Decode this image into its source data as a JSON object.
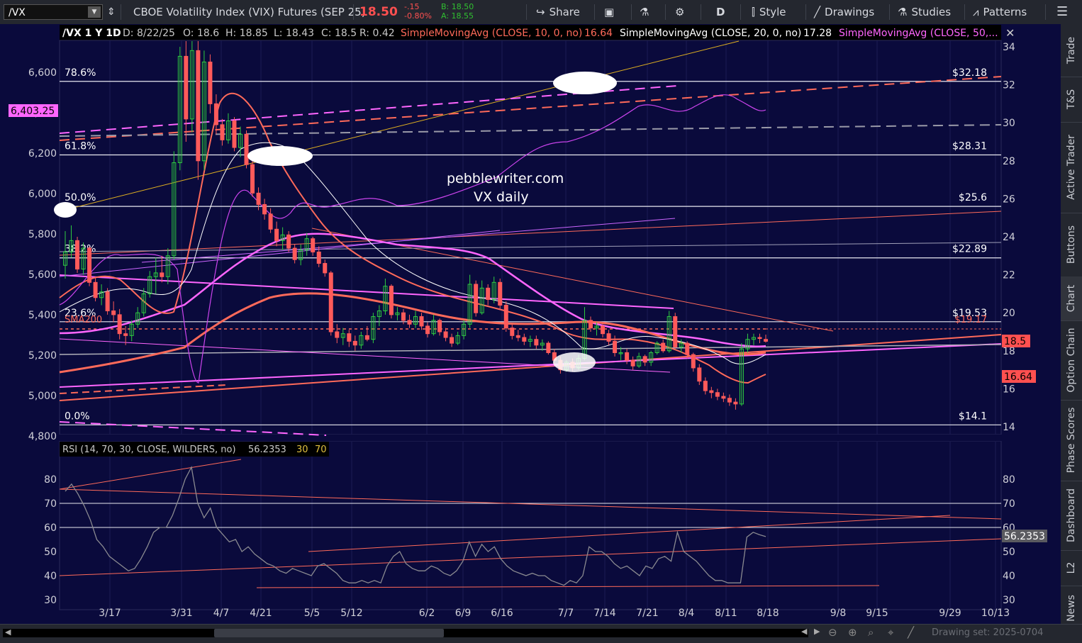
{
  "toolbar": {
    "symbol": "/VX",
    "description": "CBOE Volatility Index (VIX) Futures (SEP 25)",
    "last": "18.50",
    "change": "-.15",
    "change_pct": "-0.80%",
    "bid": "B: 18.50",
    "ask": "A: 18.55",
    "share": "Share",
    "aggregation": "D",
    "style": "Style",
    "drawings": "Drawings",
    "studies": "Studies",
    "patterns": "Patterns"
  },
  "header": {
    "symbol_period": "/VX 1 Y 1D",
    "date": "D: 8/22/25",
    "open": "O: 18.6",
    "high": "H: 18.85",
    "low": "L: 18.43",
    "close": "C: 18.5",
    "range": "R: 0.42",
    "sma10_label": "SimpleMovingAvg (CLOSE, 10, 0, no)",
    "sma10_value": "16.64",
    "sma20_label": "SimpleMovingAvg (CLOSE, 20, 0, no)",
    "sma20_value": "17.28",
    "sma50_label": "SimpleMovingAvg (CLOSE, 50,..."
  },
  "sidebar": {
    "tabs": [
      "Trade",
      "T&S",
      "Active Trader",
      "Buttons",
      "Chart",
      "Option Chain",
      "Phase Scores",
      "Dashboard",
      "L2",
      "News"
    ]
  },
  "watermark": {
    "line1": "pebblewriter.com",
    "line2": "VX daily"
  },
  "rsi_header": {
    "label": "RSI (14, 70, 30, CLOSE, WILDERS, no)",
    "value": "56.2353",
    "os": "30",
    "ob": "70"
  },
  "bottom": {
    "drawing_set": "Drawing set: 2025-0704"
  },
  "chart_data": [
    {
      "type": "candlestick",
      "title": "/VX 1 Y 1D",
      "right_axis": {
        "range": [
          14,
          34
        ],
        "ticks": [
          14,
          16,
          18,
          20,
          22,
          24,
          26,
          28,
          30,
          32,
          34
        ]
      },
      "left_axis": {
        "range": [
          4800,
          6600
        ],
        "ticks": [
          "4,800",
          "5,000",
          "5,200",
          "5,400",
          "5,600",
          "5,800",
          "6,000",
          "6,200",
          "6,400",
          "6,600"
        ],
        "marker": "6,403.25"
      },
      "x_ticks": [
        "3/17",
        "3/31",
        "4/7",
        "4/21",
        "5/5",
        "5/12",
        "6/2",
        "6/9",
        "6/16",
        "7/7",
        "7/14",
        "7/21",
        "8/4",
        "8/11",
        "8/18",
        "9/8",
        "9/15",
        "9/29",
        "10/13"
      ],
      "fib_levels": [
        {
          "pct": "78.6%",
          "price": "$32.18",
          "value": 32.18
        },
        {
          "pct": "61.8%",
          "price": "$28.31",
          "value": 28.31
        },
        {
          "pct": "50.0%",
          "price": "$25.6",
          "value": 25.6
        },
        {
          "pct": "38.2%",
          "price": "$22.89",
          "value": 22.89
        },
        {
          "pct": "23.6%",
          "price": "$19.53",
          "value": 19.53
        },
        {
          "pct": "0.0%",
          "price": "$14.1",
          "value": 14.1
        }
      ],
      "annotations": {
        "sma200_label": "SMA200",
        "sma200_price": "$19.17",
        "last_price": "18.5",
        "sma10_price": "16.64"
      },
      "candles": [
        {
          "d": "3/10",
          "o": 22.5,
          "h": 24.3,
          "l": 21.8,
          "c": 23.2
        },
        {
          "d": "3/11",
          "o": 23.2,
          "h": 24.6,
          "l": 22.9,
          "c": 23.8
        },
        {
          "d": "3/12",
          "o": 23.8,
          "h": 24.0,
          "l": 22.1,
          "c": 22.3
        },
        {
          "d": "3/13",
          "o": 22.3,
          "h": 23.7,
          "l": 22.0,
          "c": 23.4
        },
        {
          "d": "3/14",
          "o": 23.4,
          "h": 23.5,
          "l": 21.4,
          "c": 21.6
        },
        {
          "d": "3/17",
          "o": 21.6,
          "h": 21.9,
          "l": 20.6,
          "c": 20.8
        },
        {
          "d": "3/18",
          "o": 20.8,
          "h": 21.5,
          "l": 20.4,
          "c": 21.1
        },
        {
          "d": "3/19",
          "o": 21.1,
          "h": 21.3,
          "l": 19.9,
          "c": 20.1
        },
        {
          "d": "3/20",
          "o": 20.1,
          "h": 20.6,
          "l": 19.5,
          "c": 19.9
        },
        {
          "d": "3/21",
          "o": 19.9,
          "h": 20.2,
          "l": 18.6,
          "c": 18.9
        },
        {
          "d": "3/24",
          "o": 18.9,
          "h": 19.3,
          "l": 18.3,
          "c": 18.8
        },
        {
          "d": "3/25",
          "o": 18.8,
          "h": 19.6,
          "l": 18.5,
          "c": 19.4
        },
        {
          "d": "3/26",
          "o": 19.4,
          "h": 20.3,
          "l": 19.2,
          "c": 20.0
        },
        {
          "d": "3/27",
          "o": 20.0,
          "h": 21.3,
          "l": 19.8,
          "c": 21.0
        },
        {
          "d": "3/28",
          "o": 21.0,
          "h": 22.2,
          "l": 20.8,
          "c": 21.9
        },
        {
          "d": "3/31",
          "o": 21.9,
          "h": 22.9,
          "l": 21.0,
          "c": 22.1
        },
        {
          "d": "4/1",
          "o": 22.1,
          "h": 23.0,
          "l": 21.6,
          "c": 21.9
        },
        {
          "d": "4/2",
          "o": 21.9,
          "h": 23.4,
          "l": 21.5,
          "c": 23.0
        },
        {
          "d": "4/3",
          "o": 23.0,
          "h": 28.5,
          "l": 22.8,
          "c": 27.9
        },
        {
          "d": "4/4",
          "o": 27.9,
          "h": 34.0,
          "l": 27.5,
          "c": 33.5
        },
        {
          "d": "4/7",
          "o": 33.5,
          "h": 36.5,
          "l": 29.0,
          "c": 30.2
        },
        {
          "d": "4/8",
          "o": 30.2,
          "h": 34.8,
          "l": 29.5,
          "c": 33.8
        },
        {
          "d": "4/9",
          "o": 33.8,
          "h": 34.5,
          "l": 27.0,
          "c": 28.0
        },
        {
          "d": "4/10",
          "o": 28.0,
          "h": 33.8,
          "l": 27.5,
          "c": 33.2
        },
        {
          "d": "4/11",
          "o": 33.2,
          "h": 33.6,
          "l": 30.5,
          "c": 31.0
        },
        {
          "d": "4/14",
          "o": 31.0,
          "h": 31.5,
          "l": 29.4,
          "c": 29.9
        },
        {
          "d": "4/15",
          "o": 29.9,
          "h": 30.2,
          "l": 28.8,
          "c": 29.1
        },
        {
          "d": "4/16",
          "o": 29.1,
          "h": 30.5,
          "l": 28.9,
          "c": 30.1
        },
        {
          "d": "4/17",
          "o": 30.1,
          "h": 30.3,
          "l": 28.5,
          "c": 28.7
        },
        {
          "d": "4/21",
          "o": 28.7,
          "h": 29.8,
          "l": 28.2,
          "c": 29.4
        },
        {
          "d": "4/22",
          "o": 29.4,
          "h": 29.6,
          "l": 27.6,
          "c": 27.8
        },
        {
          "d": "4/23",
          "o": 27.8,
          "h": 28.0,
          "l": 26.1,
          "c": 26.3
        },
        {
          "d": "4/24",
          "o": 26.3,
          "h": 26.6,
          "l": 25.4,
          "c": 25.7
        },
        {
          "d": "4/25",
          "o": 25.7,
          "h": 26.0,
          "l": 24.9,
          "c": 25.2
        },
        {
          "d": "4/28",
          "o": 25.2,
          "h": 25.5,
          "l": 24.2,
          "c": 24.4
        },
        {
          "d": "4/29",
          "o": 24.4,
          "h": 24.8,
          "l": 23.5,
          "c": 23.8
        },
        {
          "d": "4/30",
          "o": 23.8,
          "h": 24.5,
          "l": 23.3,
          "c": 24.1
        },
        {
          "d": "5/1",
          "o": 24.1,
          "h": 24.3,
          "l": 23.2,
          "c": 23.4
        },
        {
          "d": "5/2",
          "o": 23.4,
          "h": 23.6,
          "l": 22.6,
          "c": 22.8
        },
        {
          "d": "5/5",
          "o": 22.8,
          "h": 23.6,
          "l": 22.5,
          "c": 23.3
        },
        {
          "d": "5/6",
          "o": 23.3,
          "h": 24.2,
          "l": 23.0,
          "c": 23.9
        },
        {
          "d": "5/7",
          "o": 23.9,
          "h": 24.0,
          "l": 23.0,
          "c": 23.2
        },
        {
          "d": "5/8",
          "o": 23.2,
          "h": 23.5,
          "l": 22.4,
          "c": 22.6
        },
        {
          "d": "5/9",
          "o": 22.6,
          "h": 22.8,
          "l": 21.9,
          "c": 22.1
        },
        {
          "d": "5/12",
          "o": 22.1,
          "h": 22.2,
          "l": 18.8,
          "c": 19.0
        },
        {
          "d": "5/13",
          "o": 19.0,
          "h": 19.4,
          "l": 18.4,
          "c": 18.7
        },
        {
          "d": "5/14",
          "o": 18.7,
          "h": 19.2,
          "l": 18.3,
          "c": 18.9
        },
        {
          "d": "5/15",
          "o": 18.9,
          "h": 19.1,
          "l": 18.2,
          "c": 18.5
        },
        {
          "d": "5/16",
          "o": 18.5,
          "h": 18.8,
          "l": 18.0,
          "c": 18.3
        },
        {
          "d": "5/19",
          "o": 18.3,
          "h": 19.0,
          "l": 18.1,
          "c": 18.8
        },
        {
          "d": "5/20",
          "o": 18.8,
          "h": 19.3,
          "l": 18.5,
          "c": 18.6
        },
        {
          "d": "5/21",
          "o": 18.6,
          "h": 20.0,
          "l": 18.4,
          "c": 19.8
        },
        {
          "d": "5/22",
          "o": 19.8,
          "h": 20.4,
          "l": 19.3,
          "c": 20.1
        },
        {
          "d": "5/23",
          "o": 20.1,
          "h": 21.8,
          "l": 19.9,
          "c": 21.4
        },
        {
          "d": "5/27",
          "o": 21.4,
          "h": 21.5,
          "l": 19.7,
          "c": 19.9
        },
        {
          "d": "5/28",
          "o": 19.9,
          "h": 20.3,
          "l": 19.6,
          "c": 20.0
        },
        {
          "d": "5/29",
          "o": 20.0,
          "h": 20.2,
          "l": 19.4,
          "c": 19.6
        },
        {
          "d": "5/30",
          "o": 19.6,
          "h": 19.9,
          "l": 19.2,
          "c": 19.4
        },
        {
          "d": "6/2",
          "o": 19.4,
          "h": 20.1,
          "l": 19.2,
          "c": 19.8
        },
        {
          "d": "6/3",
          "o": 19.8,
          "h": 20.0,
          "l": 19.1,
          "c": 19.3
        },
        {
          "d": "6/4",
          "o": 19.3,
          "h": 19.5,
          "l": 18.7,
          "c": 18.9
        },
        {
          "d": "6/5",
          "o": 18.9,
          "h": 19.9,
          "l": 18.8,
          "c": 19.6
        },
        {
          "d": "6/6",
          "o": 19.6,
          "h": 19.7,
          "l": 18.8,
          "c": 19.0
        },
        {
          "d": "6/9",
          "o": 19.0,
          "h": 19.2,
          "l": 18.5,
          "c": 18.7
        },
        {
          "d": "6/10",
          "o": 18.7,
          "h": 18.9,
          "l": 18.2,
          "c": 18.4
        },
        {
          "d": "6/11",
          "o": 18.4,
          "h": 19.0,
          "l": 18.3,
          "c": 18.8
        },
        {
          "d": "6/12",
          "o": 18.8,
          "h": 19.6,
          "l": 18.6,
          "c": 19.4
        },
        {
          "d": "6/13",
          "o": 19.4,
          "h": 22.0,
          "l": 19.2,
          "c": 21.5
        },
        {
          "d": "6/16",
          "o": 21.5,
          "h": 21.7,
          "l": 19.8,
          "c": 20.0
        },
        {
          "d": "6/17",
          "o": 20.0,
          "h": 21.7,
          "l": 19.9,
          "c": 21.3
        },
        {
          "d": "6/18",
          "o": 21.3,
          "h": 21.5,
          "l": 20.4,
          "c": 20.7
        },
        {
          "d": "6/19",
          "o": 20.7,
          "h": 21.9,
          "l": 20.5,
          "c": 21.6
        },
        {
          "d": "6/20",
          "o": 21.6,
          "h": 21.8,
          "l": 20.2,
          "c": 20.4
        },
        {
          "d": "6/23",
          "o": 20.4,
          "h": 20.6,
          "l": 19.0,
          "c": 19.2
        },
        {
          "d": "6/24",
          "o": 19.2,
          "h": 19.4,
          "l": 18.6,
          "c": 18.8
        },
        {
          "d": "6/25",
          "o": 18.8,
          "h": 19.1,
          "l": 18.5,
          "c": 18.7
        },
        {
          "d": "6/26",
          "o": 18.7,
          "h": 18.9,
          "l": 18.3,
          "c": 18.5
        },
        {
          "d": "6/27",
          "o": 18.5,
          "h": 18.8,
          "l": 18.2,
          "c": 18.6
        },
        {
          "d": "6/30",
          "o": 18.6,
          "h": 18.8,
          "l": 18.1,
          "c": 18.3
        },
        {
          "d": "7/1",
          "o": 18.3,
          "h": 18.6,
          "l": 18.0,
          "c": 18.4
        },
        {
          "d": "7/2",
          "o": 18.4,
          "h": 18.5,
          "l": 17.8,
          "c": 17.9
        },
        {
          "d": "7/3",
          "o": 17.9,
          "h": 18.1,
          "l": 17.3,
          "c": 17.5
        },
        {
          "d": "7/7",
          "o": 17.5,
          "h": 17.7,
          "l": 16.8,
          "c": 17.0
        },
        {
          "d": "7/8",
          "o": 17.0,
          "h": 17.5,
          "l": 16.9,
          "c": 17.4
        },
        {
          "d": "7/9",
          "o": 17.4,
          "h": 17.6,
          "l": 16.9,
          "c": 17.1
        },
        {
          "d": "7/10",
          "o": 17.1,
          "h": 17.8,
          "l": 17.0,
          "c": 17.6
        },
        {
          "d": "7/11",
          "o": 17.6,
          "h": 20.3,
          "l": 17.5,
          "c": 19.6
        },
        {
          "d": "7/14",
          "o": 19.6,
          "h": 19.8,
          "l": 19.0,
          "c": 19.2
        },
        {
          "d": "7/15",
          "o": 19.2,
          "h": 19.5,
          "l": 18.8,
          "c": 19.3
        },
        {
          "d": "7/16",
          "o": 19.3,
          "h": 19.4,
          "l": 18.7,
          "c": 18.9
        },
        {
          "d": "7/17",
          "o": 18.9,
          "h": 19.1,
          "l": 18.3,
          "c": 18.5
        },
        {
          "d": "7/18",
          "o": 18.5,
          "h": 18.8,
          "l": 17.7,
          "c": 17.9
        },
        {
          "d": "7/21",
          "o": 17.9,
          "h": 18.2,
          "l": 17.5,
          "c": 17.9
        },
        {
          "d": "7/22",
          "o": 17.9,
          "h": 18.1,
          "l": 17.3,
          "c": 17.5
        },
        {
          "d": "7/23",
          "o": 17.5,
          "h": 17.7,
          "l": 17.0,
          "c": 17.2
        },
        {
          "d": "7/24",
          "o": 17.2,
          "h": 17.9,
          "l": 17.1,
          "c": 17.7
        },
        {
          "d": "7/25",
          "o": 17.7,
          "h": 17.8,
          "l": 17.2,
          "c": 17.4
        },
        {
          "d": "7/28",
          "o": 17.4,
          "h": 18.0,
          "l": 17.2,
          "c": 17.9
        },
        {
          "d": "7/29",
          "o": 17.9,
          "h": 18.5,
          "l": 17.8,
          "c": 18.4
        },
        {
          "d": "7/30",
          "o": 18.4,
          "h": 18.6,
          "l": 17.9,
          "c": 18.0
        },
        {
          "d": "7/31",
          "o": 18.0,
          "h": 20.1,
          "l": 17.9,
          "c": 19.8
        },
        {
          "d": "8/1",
          "o": 19.8,
          "h": 20.0,
          "l": 18.1,
          "c": 18.2
        },
        {
          "d": "8/4",
          "o": 18.2,
          "h": 18.6,
          "l": 17.9,
          "c": 18.4
        },
        {
          "d": "8/5",
          "o": 18.4,
          "h": 18.5,
          "l": 17.6,
          "c": 17.8
        },
        {
          "d": "8/6",
          "o": 17.8,
          "h": 17.9,
          "l": 16.9,
          "c": 17.1
        },
        {
          "d": "8/7",
          "o": 17.1,
          "h": 17.3,
          "l": 16.2,
          "c": 16.4
        },
        {
          "d": "8/8",
          "o": 16.4,
          "h": 16.6,
          "l": 15.7,
          "c": 15.9
        },
        {
          "d": "8/11",
          "o": 15.9,
          "h": 16.1,
          "l": 15.5,
          "c": 15.8
        },
        {
          "d": "8/12",
          "o": 15.8,
          "h": 16.0,
          "l": 15.4,
          "c": 15.6
        },
        {
          "d": "8/13",
          "o": 15.6,
          "h": 15.8,
          "l": 15.3,
          "c": 15.5
        },
        {
          "d": "8/14",
          "o": 15.5,
          "h": 15.7,
          "l": 15.1,
          "c": 15.3
        },
        {
          "d": "8/15",
          "o": 15.3,
          "h": 15.5,
          "l": 14.9,
          "c": 15.2
        },
        {
          "d": "8/18",
          "o": 15.2,
          "h": 18.4,
          "l": 15.1,
          "c": 18.1
        },
        {
          "d": "8/19",
          "o": 18.1,
          "h": 18.9,
          "l": 17.9,
          "c": 18.6
        },
        {
          "d": "8/20",
          "o": 18.6,
          "h": 18.9,
          "l": 18.3,
          "c": 18.7
        },
        {
          "d": "8/21",
          "o": 18.7,
          "h": 18.9,
          "l": 18.4,
          "c": 18.65
        },
        {
          "d": "8/22",
          "o": 18.6,
          "h": 18.85,
          "l": 18.43,
          "c": 18.5
        }
      ]
    },
    {
      "type": "line",
      "title": "RSI (14, 70, 30, CLOSE, WILDERS, no)",
      "y_range": [
        30,
        90
      ],
      "y_ticks": [
        30,
        40,
        50,
        60,
        70,
        80
      ],
      "last_value": "56.2353",
      "rsi": [
        75,
        78,
        74,
        69,
        63,
        55,
        52,
        48,
        46,
        44,
        42,
        43,
        47,
        52,
        58,
        60,
        60,
        65,
        72,
        80,
        85,
        70,
        64,
        68,
        60,
        57,
        54,
        55,
        50,
        52,
        49,
        47,
        45,
        44,
        42,
        41,
        43,
        42,
        41,
        40,
        44,
        45,
        43,
        41,
        38,
        37,
        37,
        38,
        37,
        38,
        37,
        44,
        48,
        50,
        45,
        43,
        42,
        42,
        44,
        43,
        41,
        40,
        42,
        46,
        54,
        48,
        53,
        50,
        52,
        47,
        44,
        42,
        41,
        40,
        41,
        40,
        40,
        38,
        37,
        36,
        38,
        37,
        40,
        52,
        50,
        50,
        48,
        45,
        43,
        44,
        42,
        40,
        44,
        43,
        47,
        48,
        46,
        58,
        50,
        48,
        46,
        43,
        40,
        38,
        38,
        37,
        37,
        37,
        56,
        58,
        57,
        56.2
      ]
    }
  ]
}
